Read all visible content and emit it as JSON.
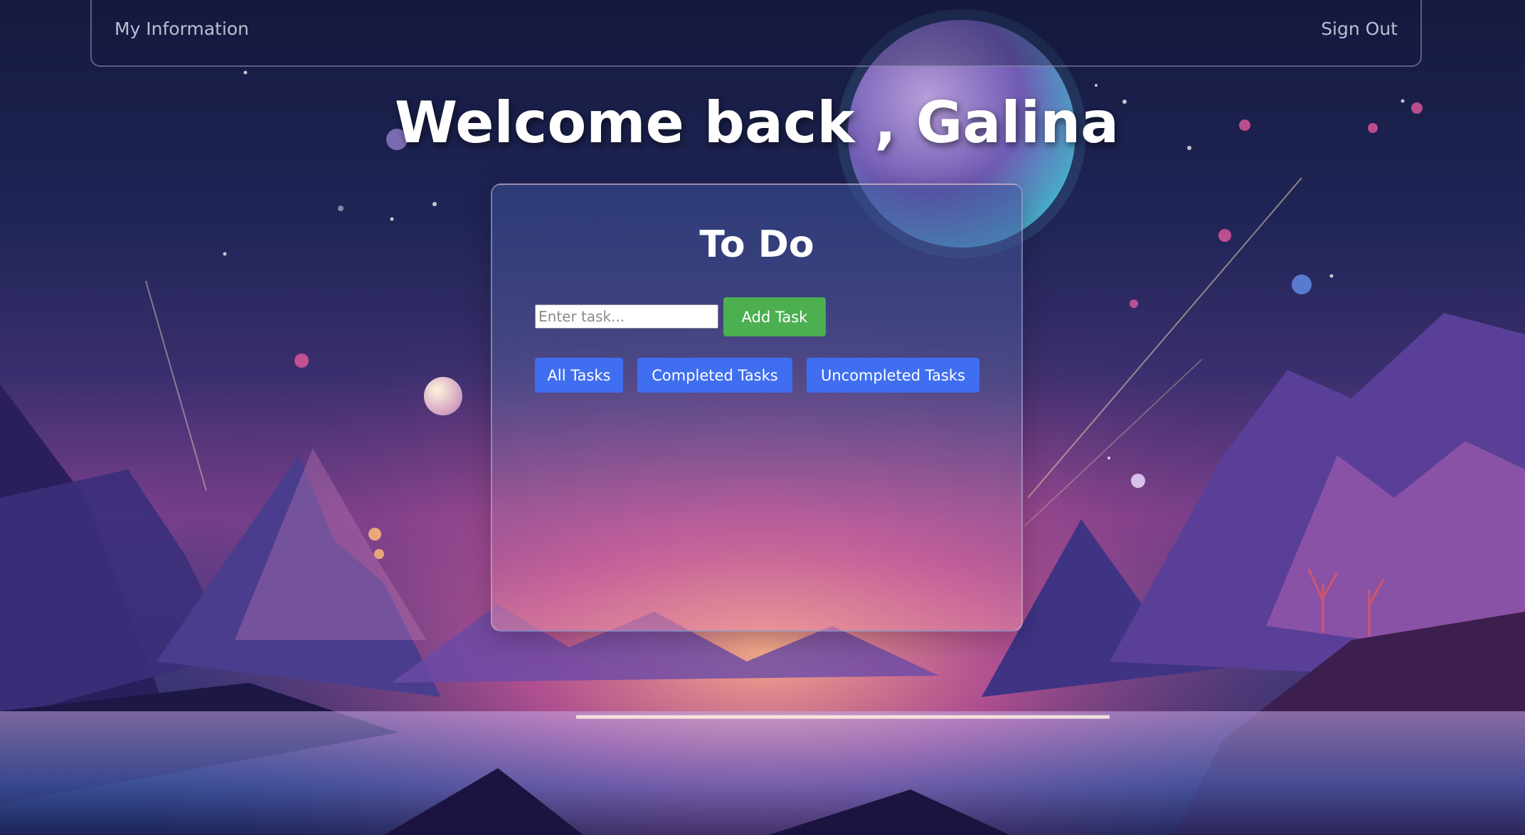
{
  "nav": {
    "left_link": "My Information",
    "right_link": "Sign Out"
  },
  "welcome": {
    "text": "Welcome back , Galina"
  },
  "todo": {
    "title": "To Do",
    "input_placeholder": "Enter task...",
    "input_value": "",
    "add_button": "Add Task",
    "filters": [
      "All Tasks",
      "Completed Tasks",
      "Uncompleted Tasks"
    ],
    "tasks": []
  },
  "colors": {
    "add_button": "#4caf50",
    "filter_button": "#3f6ef0",
    "background_top": "#161a3f",
    "background_glow": "#e27aa8"
  }
}
